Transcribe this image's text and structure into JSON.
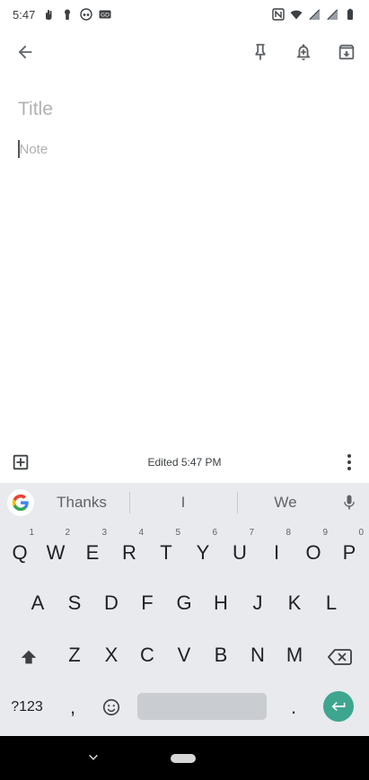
{
  "status_bar": {
    "time": "5:47",
    "icons_left": [
      "hand-icon",
      "keyhole-icon",
      "vr-icon",
      "gd-icon"
    ],
    "icons_right": [
      "nfc-icon",
      "wifi-icon",
      "signal-icon",
      "signal-icon",
      "battery-icon"
    ]
  },
  "toolbar": {
    "icons": [
      "back-arrow-icon",
      "pin-icon",
      "reminder-bell-icon",
      "archive-icon"
    ]
  },
  "note": {
    "title_placeholder": "Title",
    "body_placeholder": "Note"
  },
  "bottom_bar": {
    "edited_text": "Edited 5:47 PM",
    "icons": [
      "add-box-icon",
      "more-vert-icon"
    ]
  },
  "keyboard": {
    "suggestions": [
      "Thanks",
      "I",
      "We"
    ],
    "rows": [
      [
        {
          "label": "Q",
          "hint": "1"
        },
        {
          "label": "W",
          "hint": "2"
        },
        {
          "label": "E",
          "hint": "3"
        },
        {
          "label": "R",
          "hint": "4"
        },
        {
          "label": "T",
          "hint": "5"
        },
        {
          "label": "Y",
          "hint": "6"
        },
        {
          "label": "U",
          "hint": "7"
        },
        {
          "label": "I",
          "hint": "8"
        },
        {
          "label": "O",
          "hint": "9"
        },
        {
          "label": "P",
          "hint": "0"
        }
      ],
      [
        {
          "label": "A"
        },
        {
          "label": "S"
        },
        {
          "label": "D"
        },
        {
          "label": "F"
        },
        {
          "label": "G"
        },
        {
          "label": "H"
        },
        {
          "label": "J"
        },
        {
          "label": "K"
        },
        {
          "label": "L"
        }
      ],
      [
        {
          "label": "Z"
        },
        {
          "label": "X"
        },
        {
          "label": "C"
        },
        {
          "label": "V"
        },
        {
          "label": "B"
        },
        {
          "label": "N"
        },
        {
          "label": "M"
        }
      ]
    ],
    "symbols_key": "?123",
    "comma_key": ",",
    "period_key": ".",
    "accent_color": "#3ea58f"
  },
  "nav_bar": {
    "icons": [
      "nav-back-icon",
      "nav-home-pill"
    ]
  }
}
